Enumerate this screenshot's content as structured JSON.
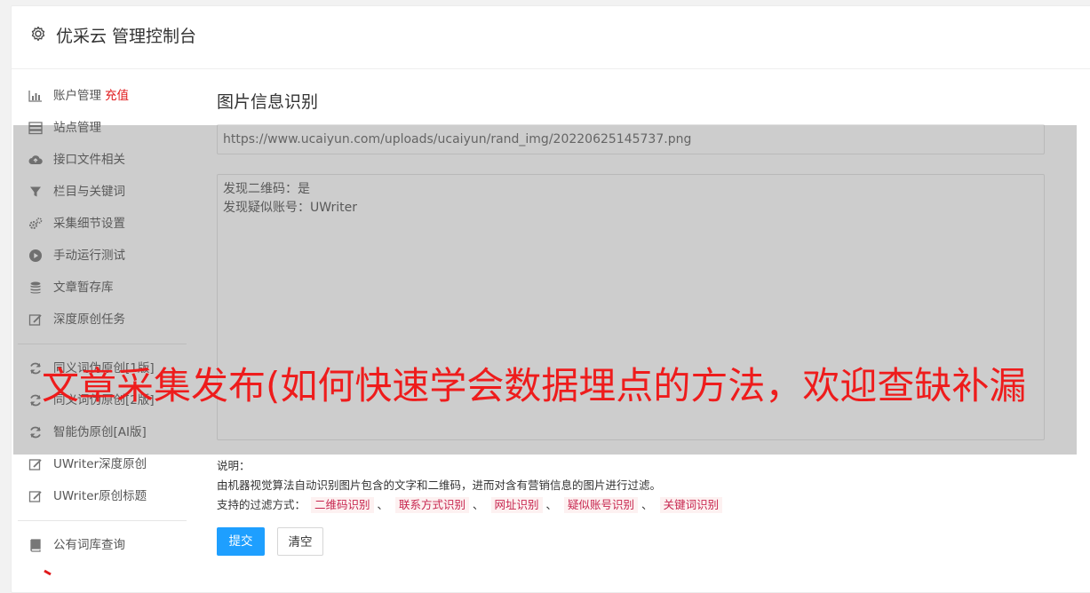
{
  "header": {
    "title": "优采云 管理控制台",
    "icon": "gear-icon"
  },
  "sidebar": {
    "items": [
      {
        "label": "账户管理",
        "extra": "充值",
        "icon": "bar-chart-icon"
      },
      {
        "label": "站点管理",
        "icon": "server-icon"
      },
      {
        "label": "接口文件相关",
        "icon": "cloud-upload-icon"
      },
      {
        "label": "栏目与关键词",
        "icon": "filter-icon"
      },
      {
        "label": "采集细节设置",
        "icon": "gears-icon"
      },
      {
        "label": "手动运行测试",
        "icon": "play-circle-icon"
      },
      {
        "label": "文章暂存库",
        "icon": "database-icon"
      },
      {
        "label": "深度原创任务",
        "icon": "edit-icon"
      }
    ],
    "items2": [
      {
        "label": "同义词伪原创[1版]",
        "icon": "refresh-icon"
      },
      {
        "label": "同义词伪原创[2版]",
        "icon": "refresh-icon"
      },
      {
        "label": "智能伪原创[AI版]",
        "icon": "refresh-icon"
      },
      {
        "label": "UWriter深度原创",
        "icon": "edit-icon"
      },
      {
        "label": "UWriter原创标题",
        "icon": "edit-icon"
      }
    ],
    "items3": [
      {
        "label": "公有词库查询",
        "icon": "book-icon"
      }
    ]
  },
  "main": {
    "title": "图片信息识别",
    "url_value": "https://www.ucaiyun.com/uploads/ucaiyun/rand_img/20220625145737.png",
    "result_lines": [
      "发现二维码：是",
      "发现疑似账号：UWriter"
    ],
    "desc_label": "说明：",
    "desc_text": "由机器视觉算法自动识别图片包含的文字和二维码，进而对含有营销信息的图片进行过滤。",
    "filter_label": "支持的过滤方式：",
    "filters": [
      "二维码识别",
      "联系方式识别",
      "网址识别",
      "疑似账号识别",
      "关键词识别"
    ],
    "filter_sep": "、",
    "submit_label": "提交",
    "clear_label": "清空"
  },
  "watermark": "文章采集发布(如何快速学会数据埋点的方法，欢迎查缺补漏",
  "colors": {
    "primary": "#1e9fff",
    "recharge": "#e0191b",
    "watermark": "#ee1c1c",
    "tag": "#c7254e"
  }
}
